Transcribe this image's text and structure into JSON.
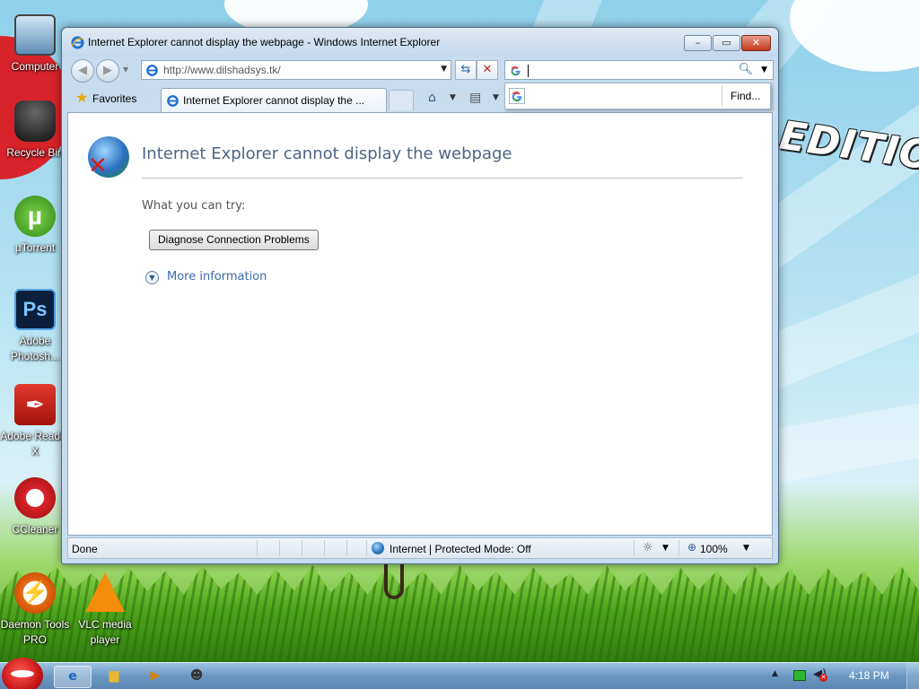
{
  "desktop": {
    "wallpaper_text": "EDITION",
    "icons": [
      {
        "label": "Computer"
      },
      {
        "label": "Recycle Bin"
      },
      {
        "label": "µTorrent"
      },
      {
        "label": "Adobe Photosh..."
      },
      {
        "label": "Adobe Reader X"
      },
      {
        "label": "CCleaner"
      },
      {
        "label": "Daemon Tools PRO"
      },
      {
        "label": "VLC media player"
      }
    ]
  },
  "window": {
    "title": "Internet Explorer cannot display the webpage - Windows Internet Explorer",
    "caption_buttons": {
      "minimize": "–",
      "maximize": "▭",
      "close": "✕"
    },
    "address": {
      "url": "http://www.dilshadsys.tk/"
    },
    "search": {
      "value": "",
      "provider_icon": "google-icon"
    },
    "suggest": {
      "find_label": "Find..."
    },
    "favorites_label": "Favorites",
    "tab": {
      "title": "Internet Explorer cannot display the ..."
    },
    "content": {
      "heading": "Internet Explorer cannot display the webpage",
      "what_you_can_try": "What you can try:",
      "diagnose_button": "Diagnose Connection Problems",
      "more_information": "More information"
    },
    "statusbar": {
      "status": "Done",
      "zone": "Internet | Protected Mode: Off",
      "zoom": "100%"
    }
  },
  "taskbar": {
    "items": [
      "internet-explorer",
      "windows-explorer",
      "media-player",
      "app"
    ],
    "clock": "4:18 PM"
  }
}
